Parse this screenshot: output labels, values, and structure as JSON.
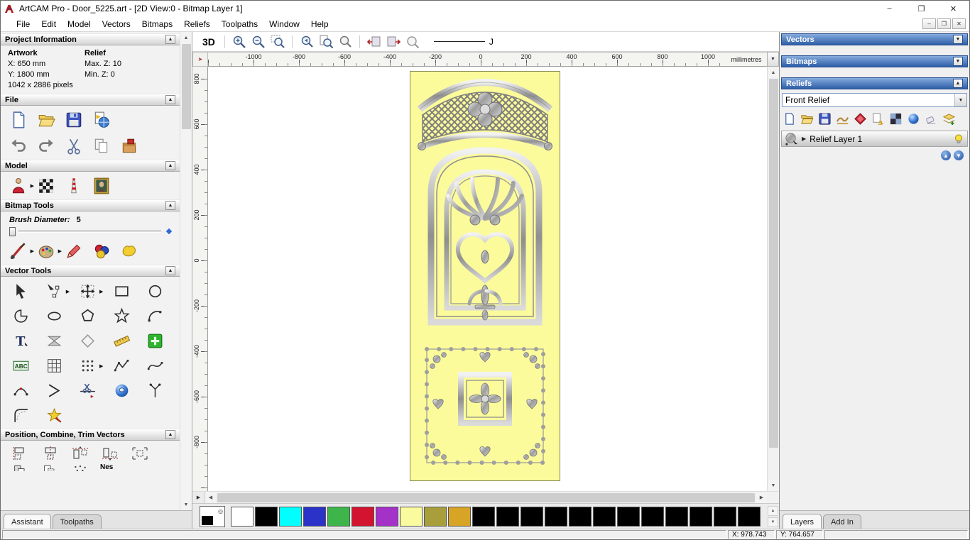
{
  "window": {
    "title": "ArtCAM Pro - Door_5225.art - [2D View:0 - Bitmap Layer 1]"
  },
  "menu": {
    "items": [
      "File",
      "Edit",
      "Model",
      "Vectors",
      "Bitmaps",
      "Reliefs",
      "Toolpaths",
      "Window",
      "Help"
    ]
  },
  "assistant": {
    "tabs": {
      "assistant": "Assistant",
      "toolpaths": "Toolpaths"
    },
    "project_information": {
      "title": "Project Information",
      "artwork_label": "Artwork",
      "relief_label": "Relief",
      "artwork_x": "X: 650 mm",
      "artwork_y": "Y: 1800 mm",
      "artwork_pixels": "1042 x 2886 pixels",
      "relief_max_z": "Max. Z: 10",
      "relief_min_z": "Min. Z: 0"
    },
    "file_title": "File",
    "model_title": "Model",
    "bitmap_tools_title": "Bitmap Tools",
    "brush_diameter_label": "Brush Diameter:",
    "brush_diameter_value": "5",
    "vector_tools_title": "Vector Tools",
    "position_title": "Position, Combine, Trim Vectors",
    "cropped_label": "Nes"
  },
  "view": {
    "toolbar": {
      "view_3d_label": "3D",
      "line_label": "J"
    },
    "rulers": {
      "horizontal": [
        "-1000",
        "-800",
        "-600",
        "-400",
        "-200",
        "0",
        "200",
        "400",
        "600",
        "800",
        "1000"
      ],
      "vertical": [
        "800",
        "600",
        "400",
        "200",
        "0",
        "-200",
        "-400",
        "-600",
        "-800"
      ],
      "units": "millimetres"
    }
  },
  "palette": {
    "colors": [
      "#ffffff",
      "#000000",
      "#00ffff",
      "#2b32c8",
      "#3eb54a",
      "#d21430",
      "#a432c8",
      "#fafa9e",
      "#a89f3c",
      "#d8a426",
      "#000000",
      "#000000",
      "#000000",
      "#000000",
      "#000000",
      "#000000",
      "#000000",
      "#000000",
      "#000000",
      "#000000",
      "#000000",
      "#000000"
    ]
  },
  "right": {
    "vectors_title": "Vectors",
    "bitmaps_title": "Bitmaps",
    "reliefs_title": "Reliefs",
    "relief_selector_value": "Front Relief",
    "layer_name": "Relief Layer 1",
    "tabs": {
      "layers": "Layers",
      "addin": "Add In"
    }
  },
  "status": {
    "x_coord": "X: 978.743",
    "y_coord": "Y: 764.657"
  }
}
